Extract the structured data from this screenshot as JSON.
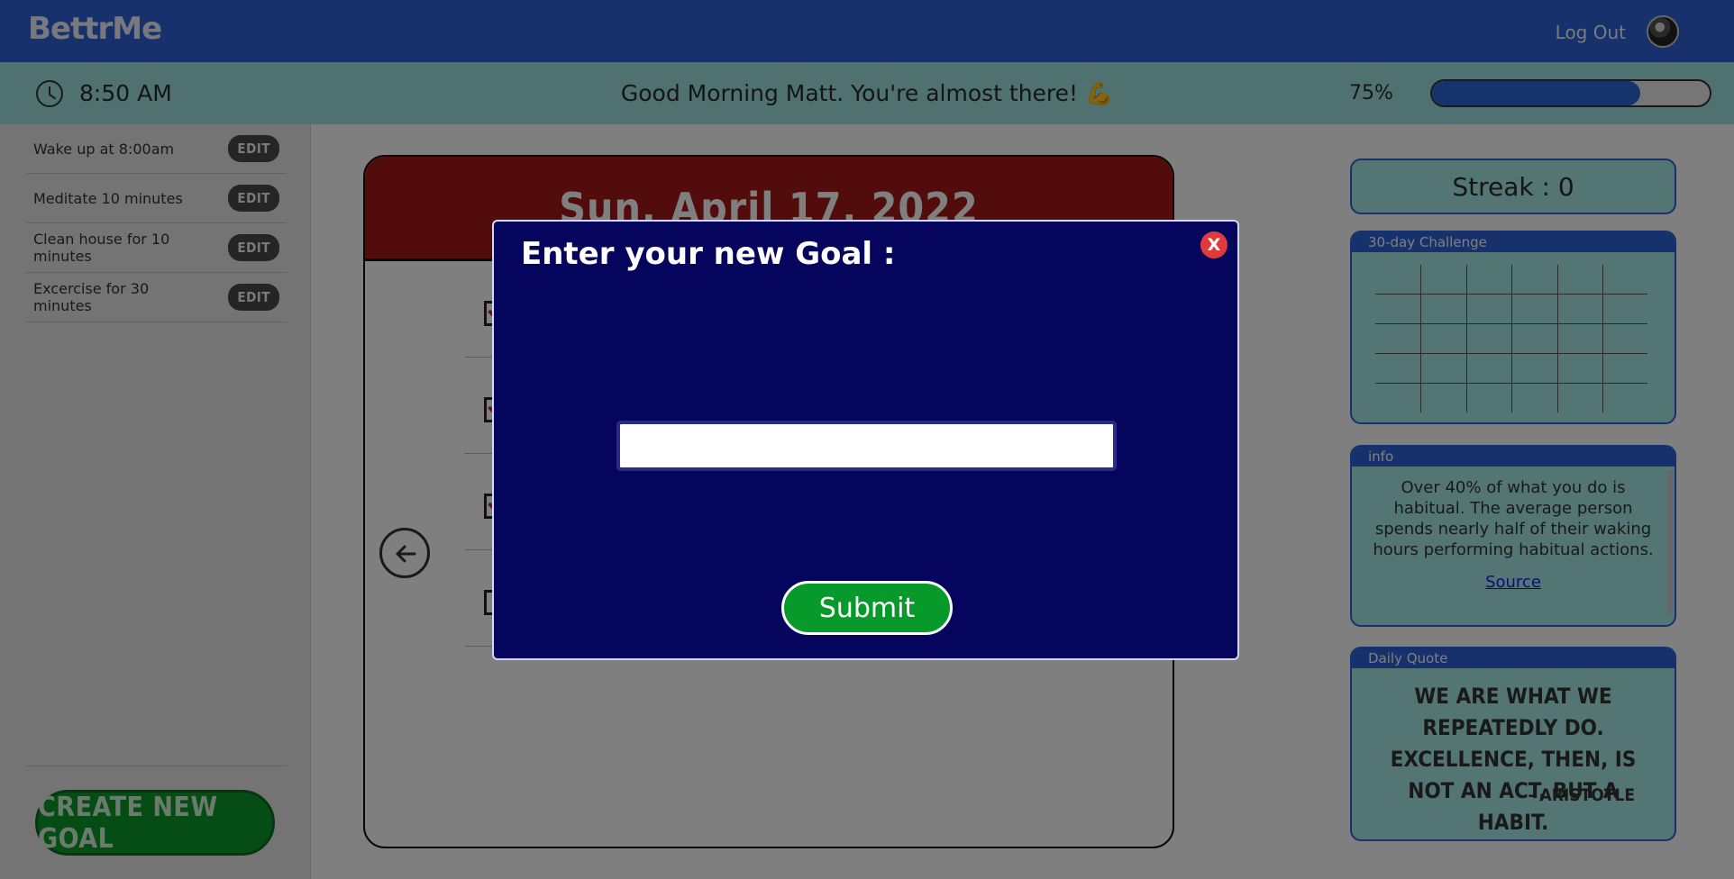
{
  "header": {
    "logo": "BettrMe",
    "logout_label": "Log Out"
  },
  "status_bar": {
    "time": "8:50 AM",
    "greeting": "Good Morning Matt.  You're almost there! 💪",
    "progress_label": "75%",
    "progress_value": 0.75
  },
  "sidebar": {
    "goals": [
      {
        "label": "Wake up at 8:00am",
        "edit": "EDIT"
      },
      {
        "label": "Meditate 10 minutes",
        "edit": "EDIT"
      },
      {
        "label": "Clean house for 10 minutes",
        "edit": "EDIT"
      },
      {
        "label": "Excercise for 30 minutes",
        "edit": "EDIT"
      }
    ],
    "create_button": "CREATE NEW GOAL"
  },
  "main": {
    "date": "Sun, April 17, 2022",
    "checks": [
      true,
      true,
      true,
      false
    ]
  },
  "right": {
    "streak": "Streak : 0",
    "challenge_title": "30-day Challenge",
    "info_title": "info",
    "info_text": "Over 40% of what you do is habitual. The average person spends nearly half of their waking hours performing habitual actions.",
    "info_link": "Source",
    "quote_title": "Daily Quote",
    "quote_text": "We are what we repeatedly do. Excellence, then, is not an act, but a habit.",
    "quote_author": "- ARISTOTLE"
  },
  "modal": {
    "title": "Enter your new Goal :",
    "close_label": "X",
    "input_value": "",
    "input_placeholder": "",
    "submit_label": "Submit"
  },
  "colors": {
    "header_blue": "#2f63d8",
    "subheader_teal": "#9fe2e0",
    "modal_navy": "#05055e",
    "submit_green": "#079a2a",
    "date_red": "#a61818",
    "close_red": "#e03b3b"
  }
}
